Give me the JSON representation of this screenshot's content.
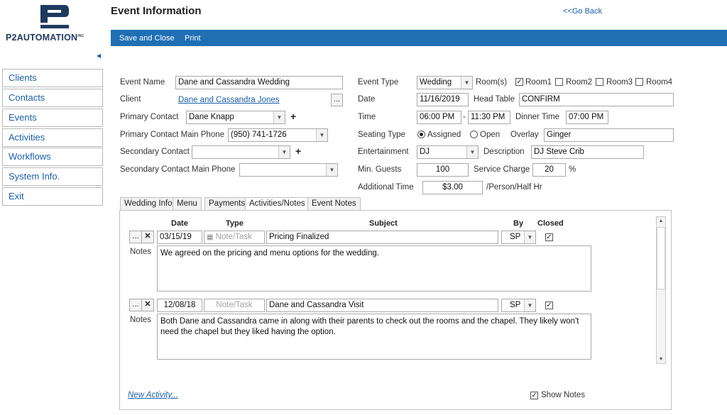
{
  "app": {
    "logo_text": "P2AUTOMATION",
    "logo_sup": "INC",
    "page_title": "Event Information",
    "go_back": "<<Go Back"
  },
  "toolbar": {
    "save_close": "Save and Close",
    "print": "Print"
  },
  "sidebar": {
    "items": [
      {
        "label": "Clients"
      },
      {
        "label": "Contacts"
      },
      {
        "label": "Events"
      },
      {
        "label": "Activities"
      },
      {
        "label": "Workflows"
      },
      {
        "label": "System Info."
      },
      {
        "label": "Exit"
      }
    ]
  },
  "form": {
    "event_name_label": "Event Name",
    "event_name": "Dane and Cassandra Wedding",
    "client_label": "Client",
    "client": "Dane and Cassandra Jones",
    "client_btn": "...",
    "primary_contact_label": "Primary Contact",
    "primary_contact": "Dane Knapp",
    "primary_phone_label": "Primary Contact Main Phone",
    "primary_phone": "(950) 741-1726",
    "secondary_contact_label": "Secondary Contact",
    "secondary_contact": "",
    "secondary_phone_label": "Secondary Contact Main Phone",
    "secondary_phone": "",
    "plus": "+",
    "event_type_label": "Event Type",
    "event_type": "Wedding",
    "rooms_label": "Room(s)",
    "rooms": [
      {
        "label": "Room1",
        "checked": true
      },
      {
        "label": "Room2",
        "checked": false
      },
      {
        "label": "Room3",
        "checked": false
      },
      {
        "label": "Room4",
        "checked": false
      }
    ],
    "date_label": "Date",
    "date": "11/16/2019",
    "head_table_label": "Head Table",
    "head_table": "CONFIRM",
    "time_label": "Time",
    "time_start": "06:00 PM",
    "time_sep": "-",
    "time_end": "11:30 PM",
    "dinner_time_label": "Dinner Time",
    "dinner_time": "07:00 PM",
    "seating_label": "Seating Type",
    "seating_assigned": "Assigned",
    "seating_open": "Open",
    "overlay_label": "Overlay",
    "overlay": "Ginger",
    "entertainment_label": "Entertainment",
    "entertainment": "DJ",
    "description_label": "Description",
    "description": "DJ Steve Crib",
    "min_guests_label": "Min. Guests",
    "min_guests": "100",
    "service_charge_label": "Service Charge",
    "service_charge": "20",
    "percent": "%",
    "additional_time_label": "Additional Time",
    "additional_time": "$3.00",
    "per_person": "/Person/Half Hr"
  },
  "tabs": [
    {
      "label": "Wedding Info"
    },
    {
      "label": "Menu"
    },
    {
      "label": "Payments"
    },
    {
      "label": "Activities/Notes"
    },
    {
      "label": "Event Notes"
    }
  ],
  "activities": {
    "headers": {
      "date": "Date",
      "type": "Type",
      "subject": "Subject",
      "by": "By",
      "closed": "Closed"
    },
    "notes_label": "Notes",
    "type_placeholder": "Note/Task",
    "rows": [
      {
        "date": "03/15/19",
        "subject": "Pricing Finalized",
        "by": "SP",
        "closed": true,
        "notes": "We agreed on the pricing and menu options for the wedding."
      },
      {
        "date": "12/08/18",
        "subject": "Dane and Cassandra Visit",
        "by": "SP",
        "closed": true,
        "notes": "Both Dane and Cassandra came in along with their parents to check out the rooms and the chapel.  They likely won't need the chapel but they liked having the option."
      }
    ],
    "new_activity": "New Activity...",
    "show_notes": "Show Notes"
  },
  "colors": {
    "accent": "#1f6fb5",
    "link": "#1a5fa8",
    "logo": "#1e3a5f"
  }
}
